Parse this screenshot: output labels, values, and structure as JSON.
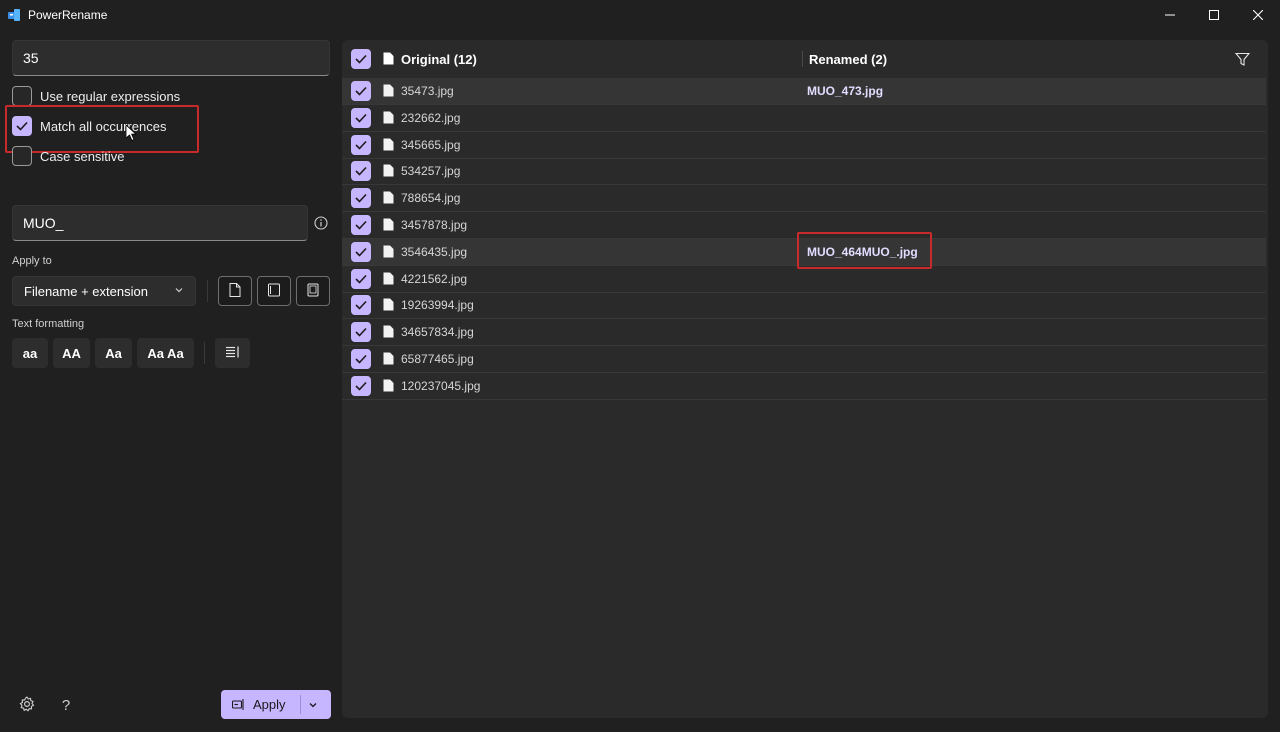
{
  "window": {
    "title": "PowerRename",
    "minimize_icon": "minimize-icon",
    "maximize_icon": "maximize-icon",
    "close_icon": "close-icon"
  },
  "search": {
    "value": "35"
  },
  "options": {
    "use_regex": {
      "label": "Use regular expressions",
      "checked": false
    },
    "match_all": {
      "label": "Match all occurrences",
      "checked": true
    },
    "case_sensitive": {
      "label": "Case sensitive",
      "checked": false
    }
  },
  "replace": {
    "value": "MUO_",
    "info_icon": "info-icon"
  },
  "apply_to": {
    "label": "Apply to",
    "selected": "Filename + extension",
    "buttons": [
      "include-files-icon",
      "include-folders-icon",
      "include-subfolders-icon"
    ]
  },
  "text_formatting": {
    "label": "Text formatting",
    "buttons": [
      "aa",
      "AA",
      "Aa",
      "Aa Aa"
    ],
    "enumerate_icon": "enumerate-icon"
  },
  "footer": {
    "settings_icon": "gear-icon",
    "help_label": "?",
    "apply_label": "Apply"
  },
  "list": {
    "original_header": "Original (12)",
    "renamed_header": "Renamed (2)",
    "filter_icon": "filter-icon",
    "rows": [
      {
        "original": "35473.jpg",
        "renamed": "MUO_473.jpg",
        "selected": true
      },
      {
        "original": "232662.jpg",
        "renamed": ""
      },
      {
        "original": "345665.jpg",
        "renamed": ""
      },
      {
        "original": "534257.jpg",
        "renamed": ""
      },
      {
        "original": "788654.jpg",
        "renamed": ""
      },
      {
        "original": "3457878.jpg",
        "renamed": ""
      },
      {
        "original": "3546435.jpg",
        "renamed": "MUO_464MUO_.jpg",
        "selected": true
      },
      {
        "original": "4221562.jpg",
        "renamed": ""
      },
      {
        "original": "19263994.jpg",
        "renamed": ""
      },
      {
        "original": "34657834.jpg",
        "renamed": ""
      },
      {
        "original": "65877465.jpg",
        "renamed": ""
      },
      {
        "original": "120237045.jpg",
        "renamed": ""
      }
    ]
  },
  "colors": {
    "accent": "#c6b5ff",
    "highlight_box": "#c72a2a",
    "background": "#202020"
  }
}
